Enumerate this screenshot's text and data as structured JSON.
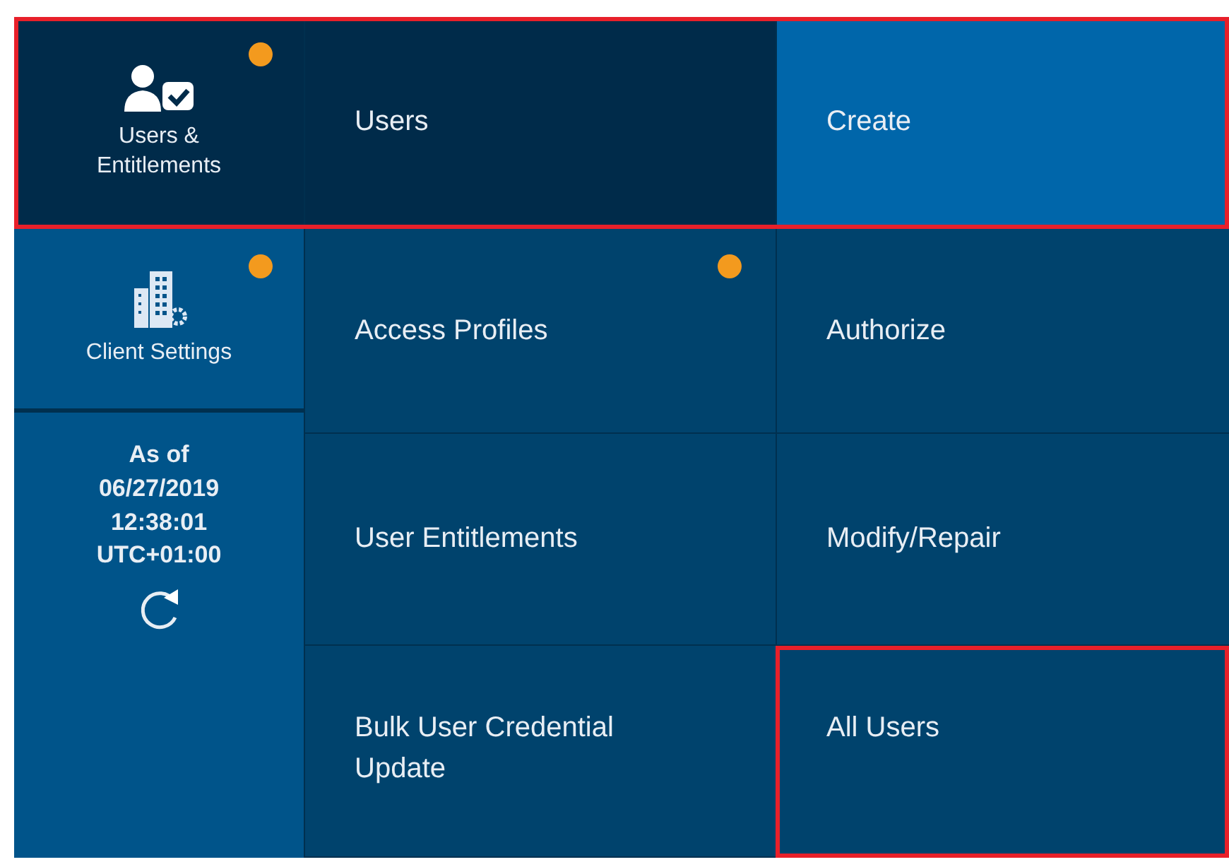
{
  "highlight_top_row": true,
  "modules": [
    {
      "label": "Users &\nEntitlements",
      "kind": "users",
      "selected": true,
      "notification": true
    },
    {
      "label": "Client Settings",
      "kind": "settings",
      "selected": false,
      "notification": true
    }
  ],
  "timestamp": {
    "lines": [
      "As of",
      "06/27/2019",
      "12:38:01",
      "UTC+01:00"
    ]
  },
  "menu": [
    {
      "label": "Users",
      "selected": true,
      "notification": false
    },
    {
      "label": "Access Profiles",
      "selected": false,
      "notification": true
    },
    {
      "label": "User Entitlements",
      "selected": false,
      "notification": false
    },
    {
      "label": "Bulk User Credential\nUpdate",
      "selected": false,
      "notification": false
    }
  ],
  "submenu": [
    {
      "label": "Create",
      "selected": true,
      "highlighted": false
    },
    {
      "label": "Authorize",
      "selected": false,
      "highlighted": false
    },
    {
      "label": "Modify/Repair",
      "selected": false,
      "highlighted": false
    },
    {
      "label": "All Users",
      "selected": false,
      "highlighted": true
    }
  ]
}
